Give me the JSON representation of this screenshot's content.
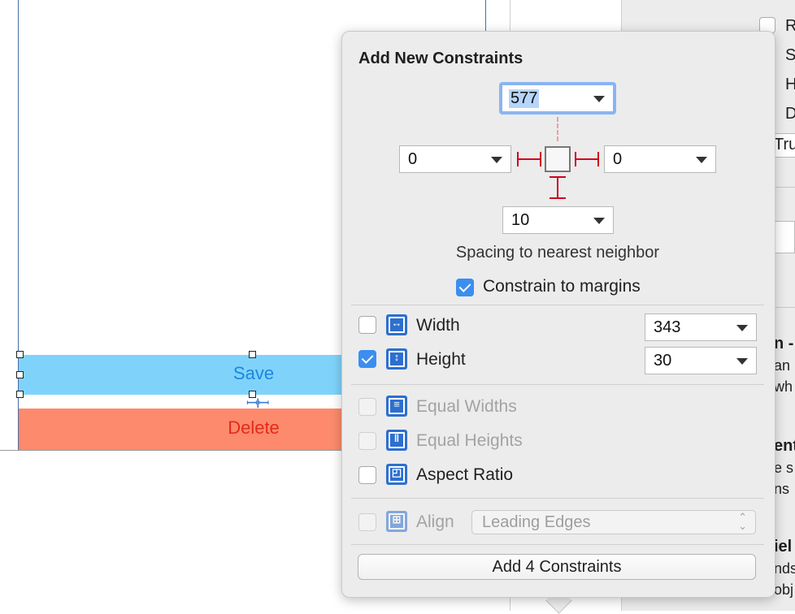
{
  "canvas": {
    "save_label": "Save",
    "delete_label": "Delete"
  },
  "inspector": {
    "check_labels": [
      "R",
      "S",
      "H",
      "D"
    ],
    "check_states": [
      false,
      false,
      true,
      true
    ],
    "field_text": "Tru",
    "text_a": "n -",
    "text_b": "an",
    "text_c": "wh",
    "text_d": "ent",
    "text_e": "e s",
    "text_f": "ns",
    "text_g": "iel",
    "text_h": "nds",
    "text_i": "obj"
  },
  "popover": {
    "title": "Add New Constraints",
    "top_value": "577",
    "left_value": "0",
    "right_value": "0",
    "bottom_value": "10",
    "spacing_caption": "Spacing to nearest neighbor",
    "constrain_margins": {
      "label": "Constrain to margins",
      "checked": true
    },
    "width": {
      "label": "Width",
      "value": "343",
      "checked": false
    },
    "height": {
      "label": "Height",
      "value": "30",
      "checked": true
    },
    "equal_widths": {
      "label": "Equal Widths",
      "checked": false,
      "enabled": false
    },
    "equal_heights": {
      "label": "Equal Heights",
      "checked": false,
      "enabled": false
    },
    "aspect_ratio": {
      "label": "Aspect Ratio",
      "checked": false
    },
    "align": {
      "label": "Align",
      "value": "Leading Edges",
      "enabled": false
    },
    "add_button": "Add 4 Constraints"
  },
  "colors": {
    "accent": "#3b8ef0",
    "pin_red": "#d0021b",
    "save_bg": "#7fd3fb",
    "delete_bg": "#fd8a6c"
  }
}
